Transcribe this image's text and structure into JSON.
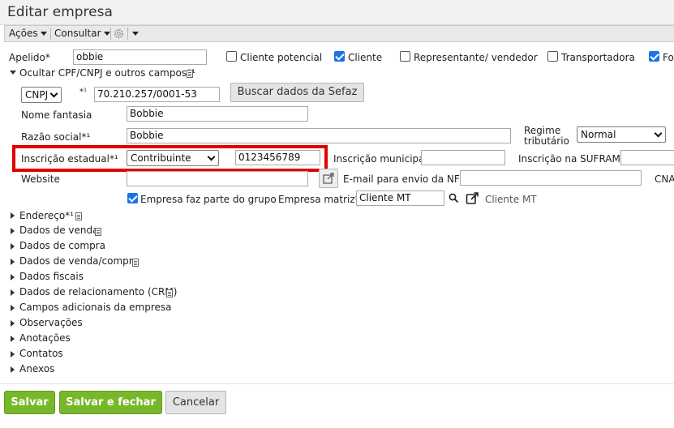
{
  "window": {
    "title": "Editar empresa"
  },
  "toolbar": {
    "actions_label": "Ações",
    "consult_label": "Consultar"
  },
  "row1": {
    "apelido_label": "Apelido*",
    "apelido_value": "obbie",
    "checkboxes": [
      {
        "label": "Cliente potencial",
        "checked": false
      },
      {
        "label": "Cliente",
        "checked": true
      },
      {
        "label": "Representante/ vendedor",
        "checked": false
      },
      {
        "label": "Transportadora",
        "checked": false
      },
      {
        "label": "For",
        "checked": true
      }
    ]
  },
  "cpf_section": {
    "toggle_label": "Ocultar CPF/CNPJ e outros campos*¹"
  },
  "doc_type": {
    "selected": "CNPJ",
    "required_mark": "*¹",
    "value": "70.210.257/0001-53",
    "sefaz_button": "Buscar dados da Sefaz"
  },
  "nome_fantasia": {
    "label": "Nome fantasia",
    "value": "Bobbie"
  },
  "razao_social": {
    "label": "Razão social*¹",
    "value": "Bobbie"
  },
  "regime": {
    "label_line1": "Regime",
    "label_line2": "tributário",
    "selected": "Normal"
  },
  "inscricao": {
    "estadual_label": "Inscrição estadual*¹",
    "estadual_select": "Contribuinte",
    "estadual_value": "0123456789",
    "municipal_label": "Inscrição municipal",
    "municipal_value": "",
    "suframa_label": "Inscrição na SUFRAMA",
    "suframa_value": ""
  },
  "website": {
    "label": "Website",
    "value": "",
    "email_label": "E-mail para envio da NF-e",
    "email_value": "",
    "cnae_label": "CNA"
  },
  "grupo": {
    "checkbox_label": "Empresa faz parte do grupo",
    "checked": true,
    "matriz_label": "Empresa matriz*",
    "matriz_value": "Cliente MT",
    "matriz_link": "Cliente MT"
  },
  "sections": [
    {
      "label": "Endereço*¹",
      "doc": true
    },
    {
      "label": "Dados de venda",
      "doc": true
    },
    {
      "label": "Dados de compra",
      "doc": false
    },
    {
      "label": "Dados de venda/compra",
      "doc": true
    },
    {
      "label": "Dados fiscais",
      "doc": false
    },
    {
      "label": "Dados de relacionamento (CRM)",
      "doc": true
    },
    {
      "label": "Campos adicionais da empresa",
      "doc": false
    },
    {
      "label": "Observações",
      "doc": false
    },
    {
      "label": "Anotações",
      "doc": false
    },
    {
      "label": "Contatos",
      "doc": false
    },
    {
      "label": "Anexos",
      "doc": false
    }
  ],
  "footer": {
    "save": "Salvar",
    "save_close": "Salvar e fechar",
    "cancel": "Cancelar"
  },
  "colors": {
    "accent_green": "#77b82a",
    "checkbox_blue": "#1a73e8",
    "highlight_red": "#e00000"
  }
}
